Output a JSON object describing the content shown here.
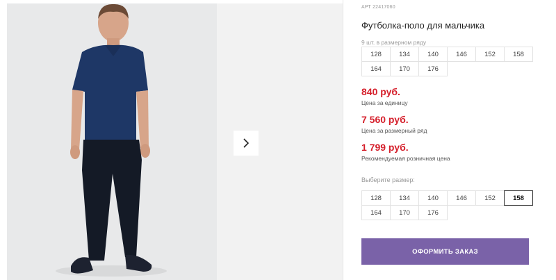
{
  "product": {
    "sku_prefix": "АРТ",
    "sku": "22417060",
    "title": "Футболка-поло для мальчика",
    "pack_note": "9 шт. в размерном ряду",
    "pack_sizes": [
      "128",
      "134",
      "140",
      "146",
      "152",
      "158",
      "164",
      "170",
      "176"
    ]
  },
  "prices": [
    {
      "value": "840 руб.",
      "label": "Цена за единицу"
    },
    {
      "value": "7 560 руб.",
      "label": "Цена за размерный ряд"
    },
    {
      "value": "1 799 руб.",
      "label": "Рекомендуемая розничная цена"
    }
  ],
  "size_picker": {
    "label": "Выберите размер:",
    "sizes": [
      "128",
      "134",
      "140",
      "146",
      "152",
      "158",
      "164",
      "170",
      "176"
    ],
    "selected": "158"
  },
  "order_button": "ОФОРМИТЬ ЗАКАЗ",
  "icons": {
    "next": "chevron-right-icon"
  },
  "colors": {
    "price": "#d51f2b",
    "accent": "#7a62a8",
    "shirt": "#1e3766",
    "pants": "#141a26"
  }
}
